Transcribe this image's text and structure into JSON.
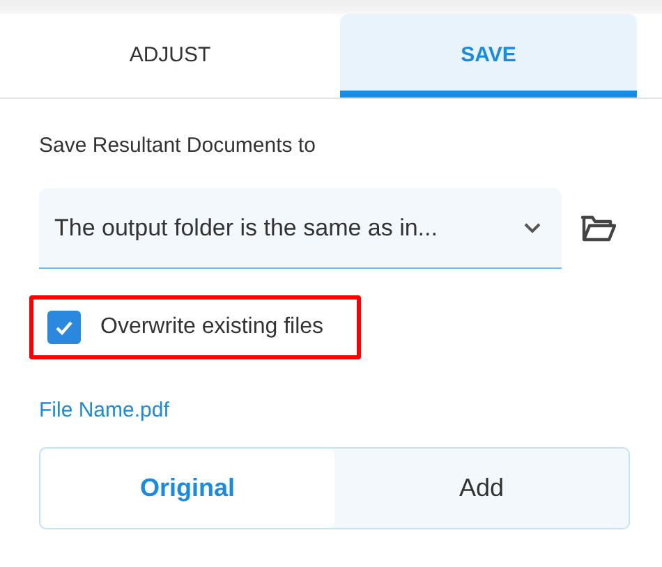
{
  "tabs": [
    {
      "label": "ADJUST",
      "selected": false
    },
    {
      "label": "SAVE",
      "selected": true
    }
  ],
  "save_to": {
    "label": "Save Resultant Documents to",
    "dropdown_value": "The output folder is the same as in..."
  },
  "overwrite": {
    "label": "Overwrite existing files",
    "checked": true,
    "highlighted": true
  },
  "file_name": "File Name.pdf",
  "name_modes": [
    {
      "label": "Original",
      "selected": true
    },
    {
      "label": "Add",
      "selected": false
    }
  ]
}
